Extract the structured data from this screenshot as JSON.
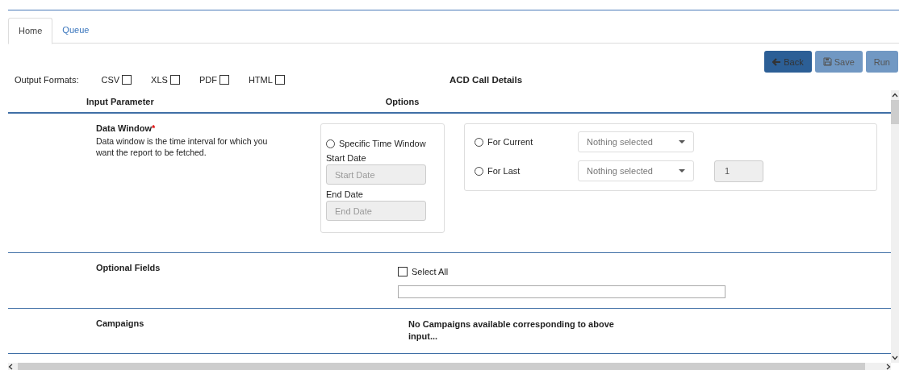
{
  "tabs": [
    {
      "label": "Home",
      "selected": true
    },
    {
      "label": "Queue",
      "selected": false
    }
  ],
  "buttons": [
    {
      "label": "Back",
      "kind": "back",
      "disabled": false
    },
    {
      "label": "Save",
      "kind": "save",
      "disabled": true
    },
    {
      "label": "Run",
      "kind": "run",
      "disabled": true
    }
  ],
  "output_formats": {
    "label": "Output Formats:",
    "options": [
      {
        "label": "CSV",
        "checked": false
      },
      {
        "label": "XLS",
        "checked": false
      },
      {
        "label": "PDF",
        "checked": false
      },
      {
        "label": "HTML",
        "checked": false
      }
    ]
  },
  "report_title": "ACD Call Details",
  "columns": [
    "Input Parameter",
    "Options"
  ],
  "data_window": {
    "title": "Data Window",
    "required_mark": "*",
    "description": "Data window is the time interval for which you want the report to be fetched.",
    "specific": {
      "label": "Specific Time Window",
      "selected": false,
      "fields": [
        {
          "label": "Start Date",
          "placeholder": "Start Date",
          "disabled": true
        },
        {
          "label": "End Date",
          "placeholder": "End Date",
          "disabled": true
        }
      ]
    },
    "relative": [
      {
        "label": "For Current",
        "selected": false,
        "dropdown": "Nothing selected"
      },
      {
        "label": "For Last",
        "selected": false,
        "dropdown": "Nothing selected",
        "count": {
          "value": "1",
          "disabled": true
        }
      }
    ]
  },
  "optional_fields": {
    "title": "Optional Fields",
    "select_all": {
      "label": "Select All",
      "checked": false
    }
  },
  "campaigns": {
    "title": "Campaigns",
    "message": "No Campaigns available corresponding to above input..."
  }
}
